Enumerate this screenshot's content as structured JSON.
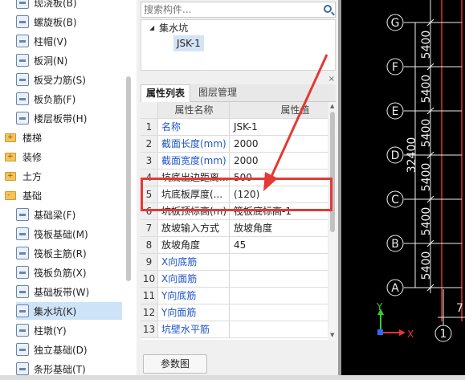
{
  "left_tree": {
    "items": [
      {
        "label": "现浇板(B)",
        "kind": "item"
      },
      {
        "label": "螺旋板(B)",
        "kind": "item"
      },
      {
        "label": "柱帽(V)",
        "kind": "item"
      },
      {
        "label": "板洞(N)",
        "kind": "item"
      },
      {
        "label": "板受力筋(S)",
        "kind": "item"
      },
      {
        "label": "板负筋(F)",
        "kind": "item"
      },
      {
        "label": "楼层板带(H)",
        "kind": "item"
      },
      {
        "label": "楼梯",
        "kind": "folder",
        "expander": "+"
      },
      {
        "label": "装修",
        "kind": "folder",
        "expander": "+"
      },
      {
        "label": "土方",
        "kind": "folder",
        "expander": "+"
      },
      {
        "label": "基础",
        "kind": "folder",
        "expander": "-"
      },
      {
        "label": "基础梁(F)",
        "kind": "item"
      },
      {
        "label": "筏板基础(M)",
        "kind": "item"
      },
      {
        "label": "筏板主筋(R)",
        "kind": "item"
      },
      {
        "label": "筏板负筋(X)",
        "kind": "item"
      },
      {
        "label": "基础板带(W)",
        "kind": "item"
      },
      {
        "label": "集水坑(K)",
        "kind": "item",
        "selected": true
      },
      {
        "label": "柱墩(Y)",
        "kind": "item"
      },
      {
        "label": "独立基础(D)",
        "kind": "item"
      },
      {
        "label": "条形基础(T)",
        "kind": "item"
      }
    ]
  },
  "search": {
    "placeholder": "搜索构件..."
  },
  "component_tree": {
    "root": "集水坑",
    "child": "JSK-1"
  },
  "tabs": [
    {
      "label": "属性列表",
      "active": true
    },
    {
      "label": "图层管理",
      "active": false
    }
  ],
  "grid": {
    "header": {
      "name": "属性名称",
      "value": "属性值"
    },
    "rows": [
      {
        "num": "1",
        "name": "名称",
        "value": "JSK-1",
        "blue": true
      },
      {
        "num": "2",
        "name": "截面长度(mm)",
        "value": "2000",
        "blue": true
      },
      {
        "num": "3",
        "name": "截面宽度(mm)",
        "value": "2000",
        "blue": true
      },
      {
        "num": "4",
        "name": "坑底出边距离...",
        "value": "500",
        "blue": false
      },
      {
        "num": "5",
        "name": "坑底板厚度(...",
        "value": "(120)",
        "blue": false
      },
      {
        "num": "6",
        "name": "坑板顶标高(m)",
        "value": "筏板底标高-1",
        "blue": false
      },
      {
        "num": "7",
        "name": "放坡输入方式",
        "value": "放坡角度",
        "blue": false
      },
      {
        "num": "8",
        "name": "放坡角度",
        "value": "45",
        "blue": false
      },
      {
        "num": "9",
        "name": "X向底筋",
        "value": "",
        "blue": true
      },
      {
        "num": "10",
        "name": "X向面筋",
        "value": "",
        "blue": true
      },
      {
        "num": "11",
        "name": "Y向底筋",
        "value": "",
        "blue": true
      },
      {
        "num": "12",
        "name": "Y向面筋",
        "value": "",
        "blue": true
      },
      {
        "num": "13",
        "name": "坑壁水平筋",
        "value": "",
        "blue": true
      }
    ]
  },
  "param_button": "参数图",
  "close_glyph": "×",
  "cad": {
    "axes": [
      "G",
      "F",
      "E",
      "D",
      "C",
      "B",
      "A"
    ],
    "dims": [
      "5400",
      "5400",
      "5400",
      "5400",
      "5400",
      "5400"
    ],
    "total": "32400",
    "bottom_axis": "1",
    "partial_dim": "7",
    "y_label": "Y",
    "x_label": "X"
  },
  "colors": {
    "highlight": "#e53935",
    "blue_text": "#1f56c8",
    "selected": "#cde3f7",
    "cad_bg": "#000000"
  }
}
